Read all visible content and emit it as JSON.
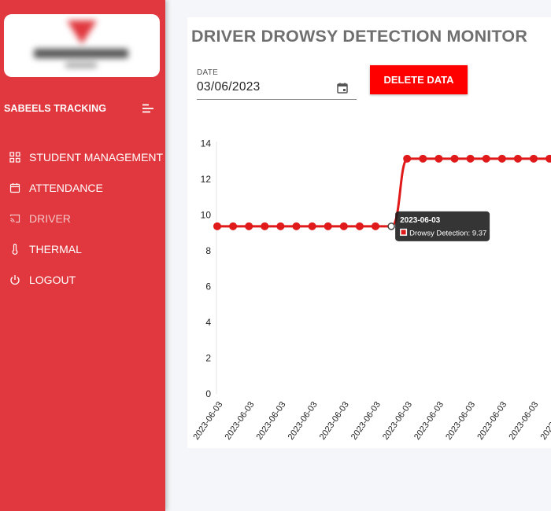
{
  "sidebar": {
    "brand": "SABEELS TRACKING",
    "items": [
      {
        "label": "STUDENT MANAGEMENT",
        "icon": "grid-icon"
      },
      {
        "label": "ATTENDANCE",
        "icon": "calendar-icon"
      },
      {
        "label": "DRIVER",
        "icon": "cast-icon"
      },
      {
        "label": "THERMAL",
        "icon": "thermometer-icon"
      },
      {
        "label": "LOGOUT",
        "icon": "power-icon"
      }
    ],
    "active_item": "DRIVER"
  },
  "main": {
    "title": "DRIVER DROWSY DETECTION MONITOR",
    "date_label": "DATE",
    "date_value": "03/06/2023",
    "delete_button": "DELETE DATA"
  },
  "tooltip": {
    "title": "2023-06-03",
    "text": "Drowsy Detection: 9.37"
  },
  "colors": {
    "sidebar": "#e0383e",
    "series": "#e01a1a",
    "button": "#ff0000"
  },
  "chart_data": {
    "type": "line",
    "title": "",
    "xlabel": "",
    "ylabel": "",
    "ylim": [
      0,
      14
    ],
    "yticks": [
      0,
      2,
      4,
      6,
      8,
      10,
      12,
      14
    ],
    "categories": [
      "2023-06-03",
      "2023-06-03",
      "2023-06-03",
      "2023-06-03",
      "2023-06-03",
      "2023-06-03",
      "2023-06-03",
      "2023-06-03",
      "2023-06-03",
      "2023-06-03",
      "2023-06-03",
      "2023-06-03",
      "2023-06-03",
      "2023-06-03",
      "2023-06-03",
      "2023-06-03",
      "2023-06-03",
      "2023-06-03",
      "2023-06-03",
      "2023-06-03",
      "2023-06-03",
      "2023-06-03"
    ],
    "tick_labels": [
      "2023-06-03",
      "2023-06-03",
      "2023-06-03",
      "2023-06-03",
      "2023-06-03",
      "2023-06-03",
      "2023-06-03",
      "2023-06-03",
      "2023-06-03",
      "2023-06-03",
      "2023-06-03",
      "2023-06-03"
    ],
    "series": [
      {
        "name": "Drowsy Detection",
        "values": [
          9.37,
          9.37,
          9.37,
          9.37,
          9.37,
          9.37,
          9.37,
          9.37,
          9.37,
          9.37,
          9.37,
          9.37,
          13.15,
          13.15,
          13.15,
          13.15,
          13.15,
          13.15,
          13.15,
          13.15,
          13.15,
          13.15
        ]
      }
    ],
    "hovered_index": 11,
    "grid": false,
    "legend": "none"
  }
}
